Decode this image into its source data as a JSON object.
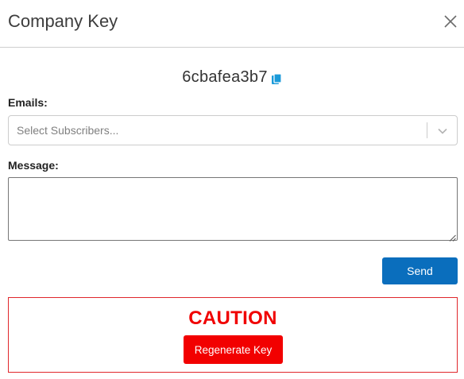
{
  "modal": {
    "title": "Company Key",
    "close_icon": "close-icon"
  },
  "key": {
    "value": "6cbafea3b7",
    "copy_icon": "copy-icon",
    "copy_icon_color": "#1a9ad9"
  },
  "form": {
    "emails_label": "Emails:",
    "emails_placeholder": "Select Subscribers...",
    "emails_dropdown_icon": "chevron-down-icon",
    "message_label": "Message:",
    "message_value": "",
    "send_label": "Send"
  },
  "caution": {
    "title": "CAUTION",
    "button_label": "Regenerate Key"
  },
  "colors": {
    "primary": "#0a6ebd",
    "danger": "#f20000",
    "border": "#cccccc"
  }
}
